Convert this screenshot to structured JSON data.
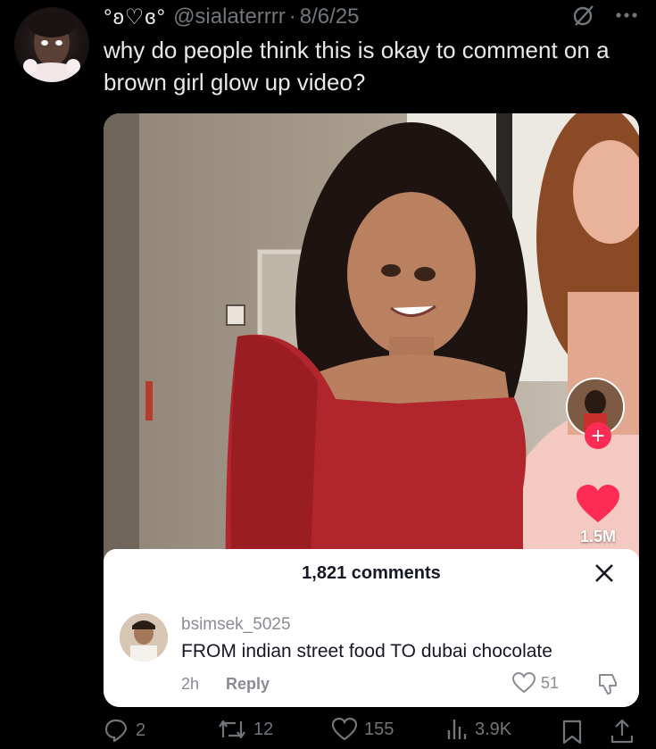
{
  "tweet": {
    "display_name": "°ʚ♡ɞ°",
    "handle": "@sialaterrrr",
    "separator": "·",
    "date": "8/6/25",
    "text": "why do people think this is okay to comment on a brown girl glow up video?"
  },
  "media_overlay": {
    "like_count": "1.5M",
    "comments": {
      "count_label": "1,821 comments",
      "items": [
        {
          "username": "bsimsek_5025",
          "text": "FROM indian street food TO dubai chocolate",
          "time": "2h",
          "reply_label": "Reply",
          "likes": "51"
        }
      ]
    }
  },
  "actions": {
    "replies": "2",
    "retweets": "12",
    "likes": "155",
    "views": "3.9K"
  },
  "icons": {
    "grok": "grok-icon",
    "more": "more-icon",
    "reply": "reply-icon",
    "retweet": "retweet-icon",
    "like": "heart-icon",
    "views": "views-icon",
    "bookmark": "bookmark-icon",
    "share": "share-icon"
  },
  "colors": {
    "background": "#000000",
    "muted_text": "#71767b",
    "tiktok_red": "#fe2c55"
  }
}
